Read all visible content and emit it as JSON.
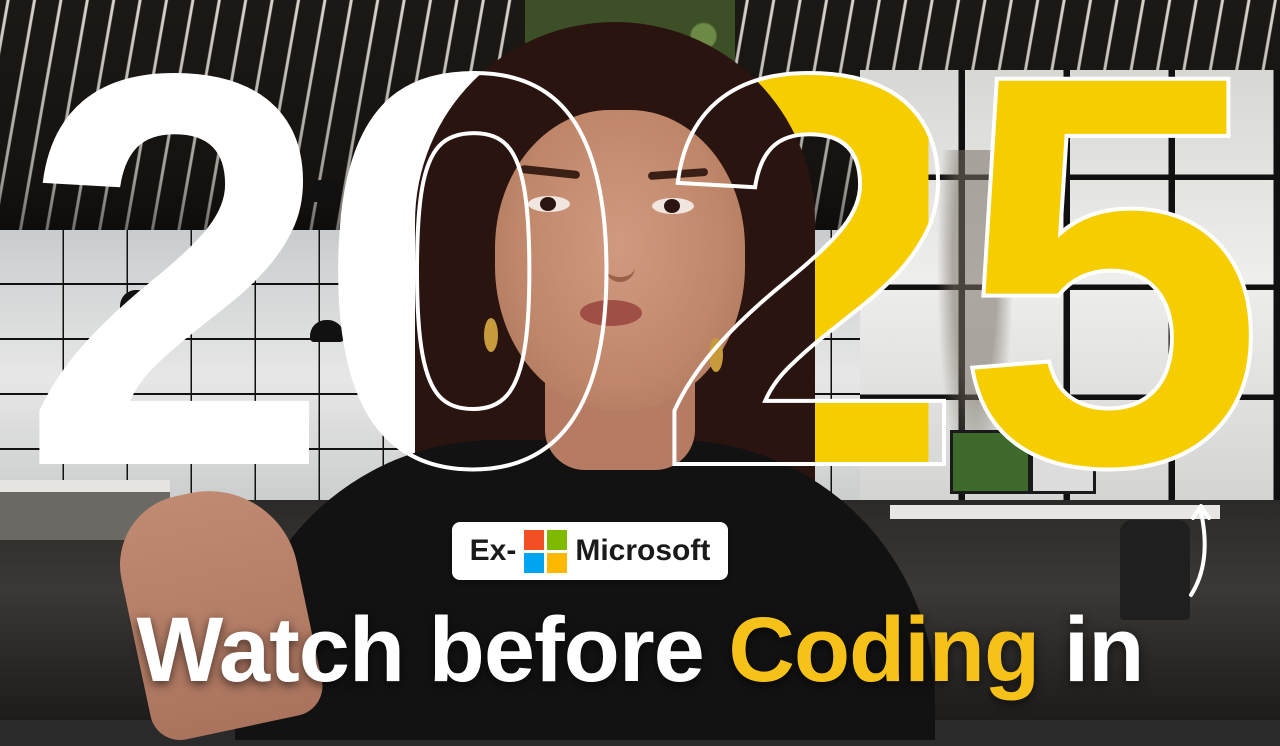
{
  "thumbnail": {
    "year_digits": [
      "2",
      "0",
      "2",
      "5"
    ],
    "badge": {
      "prefix": "Ex-",
      "company": "Microsoft",
      "logo_colors": [
        "#f25022",
        "#7fba00",
        "#00a4ef",
        "#ffb900"
      ]
    },
    "caption": {
      "part1": "Watch before ",
      "highlight": "Coding",
      "part2": " in"
    },
    "colors": {
      "accent_yellow": "#f6ce00",
      "caption_highlight": "#f6c21a",
      "white": "#ffffff"
    },
    "icons": [
      "curved-arrow-icon",
      "microsoft-logo-icon"
    ]
  }
}
